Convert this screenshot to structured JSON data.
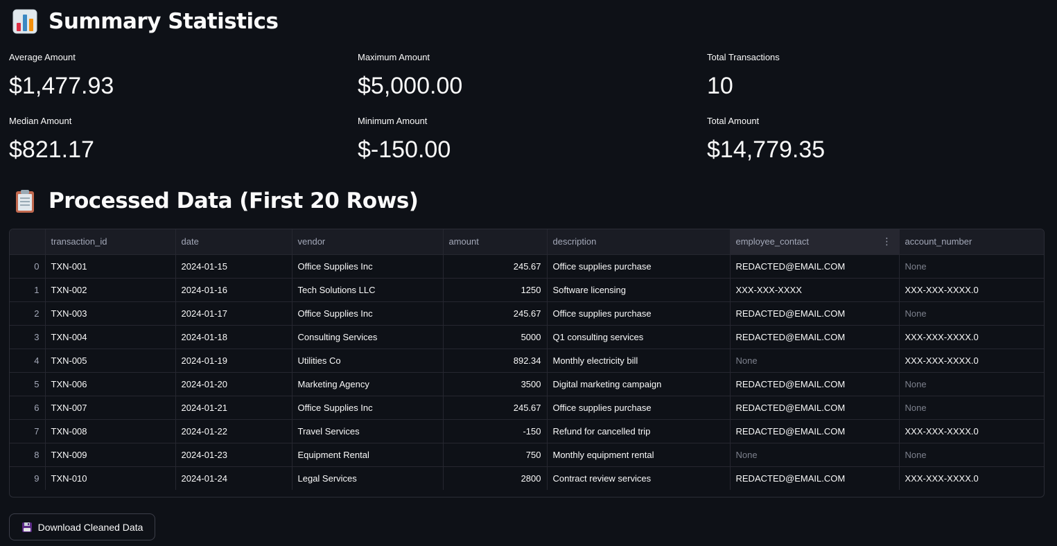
{
  "summary": {
    "heading": "Summary Statistics",
    "heading_icon": "bar-chart-icon",
    "metrics": [
      {
        "label": "Average Amount",
        "value": "$1,477.93"
      },
      {
        "label": "Maximum Amount",
        "value": "$5,000.00"
      },
      {
        "label": "Total Transactions",
        "value": "10"
      },
      {
        "label": "Median Amount",
        "value": "$821.17"
      },
      {
        "label": "Minimum Amount",
        "value": "$-150.00"
      },
      {
        "label": "Total Amount",
        "value": "$14,779.35"
      }
    ]
  },
  "processed": {
    "heading": "Processed Data (First 20 Rows)",
    "heading_icon": "clipboard-icon",
    "columns": [
      "",
      "transaction_id",
      "date",
      "vendor",
      "amount",
      "description",
      "employee_contact",
      "account_number"
    ],
    "rows": [
      [
        "0",
        "TXN-001",
        "2024-01-15",
        "Office Supplies Inc",
        "245.67",
        "Office supplies purchase",
        "REDACTED@EMAIL.COM",
        "None"
      ],
      [
        "1",
        "TXN-002",
        "2024-01-16",
        "Tech Solutions LLC",
        "1250",
        "Software licensing",
        "XXX-XXX-XXXX",
        "XXX-XXX-XXXX.0"
      ],
      [
        "2",
        "TXN-003",
        "2024-01-17",
        "Office Supplies Inc",
        "245.67",
        "Office supplies purchase",
        "REDACTED@EMAIL.COM",
        "None"
      ],
      [
        "3",
        "TXN-004",
        "2024-01-18",
        "Consulting Services",
        "5000",
        "Q1 consulting services",
        "REDACTED@EMAIL.COM",
        "XXX-XXX-XXXX.0"
      ],
      [
        "4",
        "TXN-005",
        "2024-01-19",
        "Utilities Co",
        "892.34",
        "Monthly electricity bill",
        "None",
        "XXX-XXX-XXXX.0"
      ],
      [
        "5",
        "TXN-006",
        "2024-01-20",
        "Marketing Agency",
        "3500",
        "Digital marketing campaign",
        "REDACTED@EMAIL.COM",
        "None"
      ],
      [
        "6",
        "TXN-007",
        "2024-01-21",
        "Office Supplies Inc",
        "245.67",
        "Office supplies purchase",
        "REDACTED@EMAIL.COM",
        "None"
      ],
      [
        "7",
        "TXN-008",
        "2024-01-22",
        "Travel Services",
        "-150",
        "Refund for cancelled trip",
        "REDACTED@EMAIL.COM",
        "XXX-XXX-XXXX.0"
      ],
      [
        "8",
        "TXN-009",
        "2024-01-23",
        "Equipment Rental",
        "750",
        "Monthly equipment rental",
        "None",
        "None"
      ],
      [
        "9",
        "TXN-010",
        "2024-01-24",
        "Legal Services",
        "2800",
        "Contract review services",
        "REDACTED@EMAIL.COM",
        "XXX-XXX-XXXX.0"
      ]
    ],
    "column_menu_icon": "kebab-menu-icon"
  },
  "download_button": {
    "label": "Download Cleaned Data",
    "icon": "floppy-disk-icon"
  },
  "colors": {
    "background": "#0e1117",
    "header_bg": "#1a1c24",
    "grid_line": "#262730",
    "muted_text": "#a3a8b8",
    "none_text": "#7d818d"
  }
}
